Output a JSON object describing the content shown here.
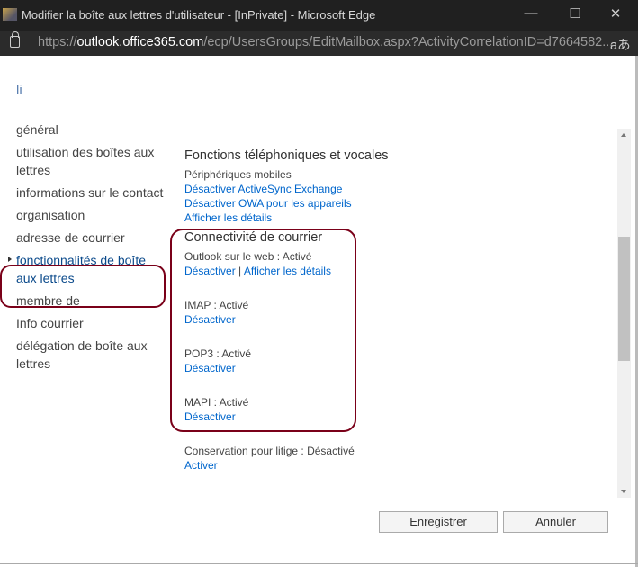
{
  "window": {
    "title": "Modifier la boîte aux lettres d'utilisateur - [InPrivate] - Microsoft Edge",
    "url_prefix": "https://",
    "url_domain": "outlook.office365.com",
    "url_path": "/ecp/UsersGroups/EditMailbox.aspx?ActivityCorrelationID=d7664582...",
    "read_aloud": "aあ"
  },
  "page": {
    "cursor_text": "li"
  },
  "nav": {
    "items": [
      {
        "label": "général"
      },
      {
        "label": "utilisation des boîtes aux lettres"
      },
      {
        "label": "informations sur le contact"
      },
      {
        "label": "organisation"
      },
      {
        "label": "adresse de courrier"
      },
      {
        "label": "fonctionnalités de boîte aux lettres",
        "selected": true
      },
      {
        "label": "membre de"
      },
      {
        "label": "Info courrier"
      },
      {
        "label": "délégation de boîte aux lettres"
      }
    ]
  },
  "content": {
    "phone": {
      "heading": "Fonctions téléphoniques et vocales",
      "mobile": "Périphériques mobiles",
      "link1": "Désactiver ActiveSync Exchange",
      "link2": "Désactiver OWA pour les appareils",
      "link3": "Afficher les détails"
    },
    "mail": {
      "heading": "Connectivité de courrier",
      "owa": "Outlook sur le web : Activé",
      "owa_disable": "Désactiver",
      "sep": " | ",
      "owa_details": "Afficher les détails",
      "imap": "IMAP : Activé",
      "imap_link": "Désactiver",
      "pop": "POP3 : Activé",
      "pop_link": "Désactiver",
      "mapi": "MAPI : Activé",
      "mapi_link": "Désactiver"
    },
    "litigation": {
      "status": "Conservation pour litige : Désactivé",
      "link": "Activer"
    }
  },
  "buttons": {
    "save": "Enregistrer",
    "cancel": "Annuler"
  },
  "colors": {
    "highlight": "#7a0019",
    "link": "#0066cc"
  }
}
